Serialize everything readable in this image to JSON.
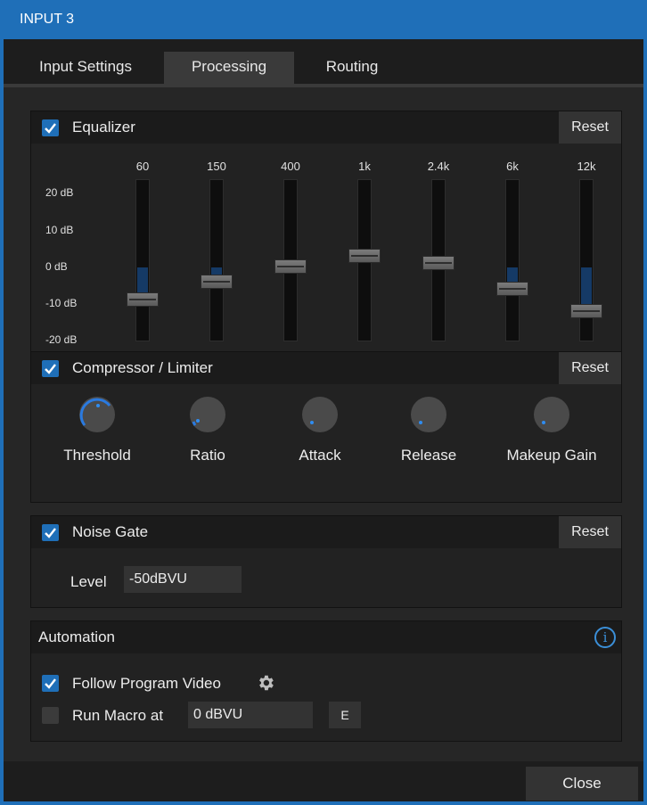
{
  "window": {
    "title": "INPUT 3"
  },
  "tabs": [
    {
      "label": "Input Settings",
      "active": false
    },
    {
      "label": "Processing",
      "active": true
    },
    {
      "label": "Routing",
      "active": false
    }
  ],
  "equalizer": {
    "enabled": true,
    "title": "Equalizer",
    "reset_label": "Reset",
    "db_labels": [
      "20 dB",
      "10 dB",
      "0 dB",
      "-10 dB",
      "-20 dB"
    ],
    "bands": [
      {
        "freq": "60",
        "gain_db": -9
      },
      {
        "freq": "150",
        "gain_db": -4
      },
      {
        "freq": "400",
        "gain_db": 0
      },
      {
        "freq": "1k",
        "gain_db": 3
      },
      {
        "freq": "2.4k",
        "gain_db": 1
      },
      {
        "freq": "6k",
        "gain_db": -6
      },
      {
        "freq": "12k",
        "gain_db": -12
      }
    ]
  },
  "compressor": {
    "enabled": true,
    "title": "Compressor / Limiter",
    "reset_label": "Reset",
    "knobs": [
      "Threshold",
      "Ratio",
      "Attack",
      "Release",
      "Makeup Gain"
    ]
  },
  "noise_gate": {
    "enabled": true,
    "title": "Noise Gate",
    "reset_label": "Reset",
    "level_label": "Level",
    "level_value": "-50dBVU"
  },
  "automation": {
    "title": "Automation",
    "info_icon": "info-icon",
    "follow_program_video": {
      "checked": true,
      "label": "Follow Program Video",
      "icon": "gear-icon"
    },
    "run_macro": {
      "checked": false,
      "label": "Run Macro at",
      "value": "0 dBVU",
      "button_label": "E"
    }
  },
  "footer": {
    "close_label": "Close"
  },
  "colors": {
    "accent": "#1f6fb8",
    "eq_fill": "#153a66",
    "panel": "#222222"
  }
}
